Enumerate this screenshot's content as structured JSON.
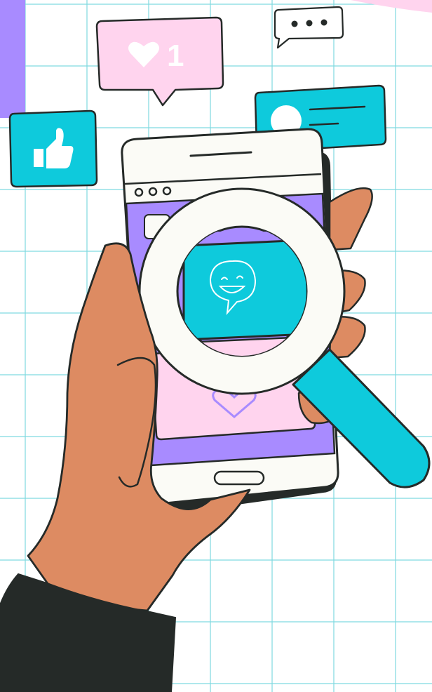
{
  "like_count": "1",
  "colors": {
    "grid": "#7fd9e0",
    "purple": "#a88bff",
    "pink": "#ffd4ee",
    "cyan": "#0ecadc",
    "skin": "#dd8b62",
    "outline": "#252a28",
    "phone": "#fbfbf6",
    "sleeve": "#252a28"
  },
  "icons": [
    "thumbs-up-icon",
    "heart-icon",
    "ellipsis-icon",
    "profile-card-icon",
    "smiley-chat-icon",
    "magnifying-glass-icon",
    "heart-outline-icon"
  ]
}
